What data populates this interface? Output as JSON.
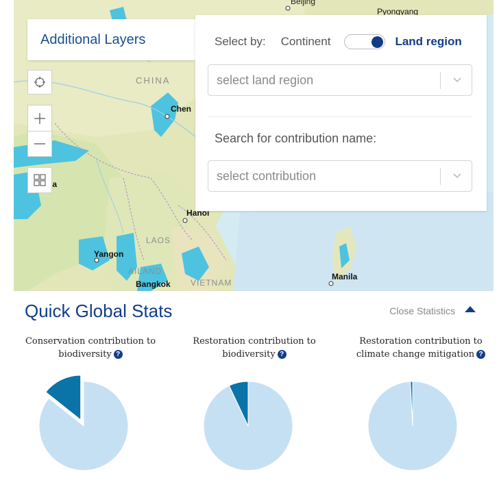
{
  "map": {
    "labels": {
      "beijing": "Beijing",
      "pyongyang": "Pyongyang",
      "china": "CHINA",
      "chengdu": "Chen",
      "dhaka": "aka",
      "hanoi": "Hanoi",
      "laos": "LAOS",
      "yangon": "Yangon",
      "thailand": "AILAND",
      "bangkok": "Bangkok",
      "vietnam": "VIETNAM",
      "manila": "Manila"
    }
  },
  "layers_tab": {
    "label": "Additional Layers"
  },
  "filters": {
    "select_by_label": "Select by:",
    "option_continent": "Continent",
    "option_land_region": "Land region",
    "toggle_on": true,
    "land_region_placeholder": "select land region",
    "search_label": "Search for contribution name:",
    "contribution_placeholder": "select contribution"
  },
  "stats": {
    "title": "Quick Global Stats",
    "close_label": "Close Statistics"
  },
  "colors": {
    "pie_light": "#c6e0f3",
    "pie_dark": "#0a73a8",
    "brand": "#123d89"
  },
  "chart_data": [
    {
      "type": "pie",
      "title_line1": "Conservation contribution to",
      "title_line2": "biodiversity",
      "slices": [
        {
          "value": 85.7
        },
        {
          "value": 14.3,
          "exploded": true
        }
      ]
    },
    {
      "type": "pie",
      "title_line1": "Restoration contribution to",
      "title_line2": "biodiversity",
      "slices": [
        {
          "value": 93
        },
        {
          "value": 7
        }
      ]
    },
    {
      "type": "pie",
      "title_line1": "Restoration contribution to",
      "title_line2": "climate change mitigation",
      "slices": [
        {
          "value": 99.2
        },
        {
          "value": 0.8
        }
      ]
    }
  ]
}
